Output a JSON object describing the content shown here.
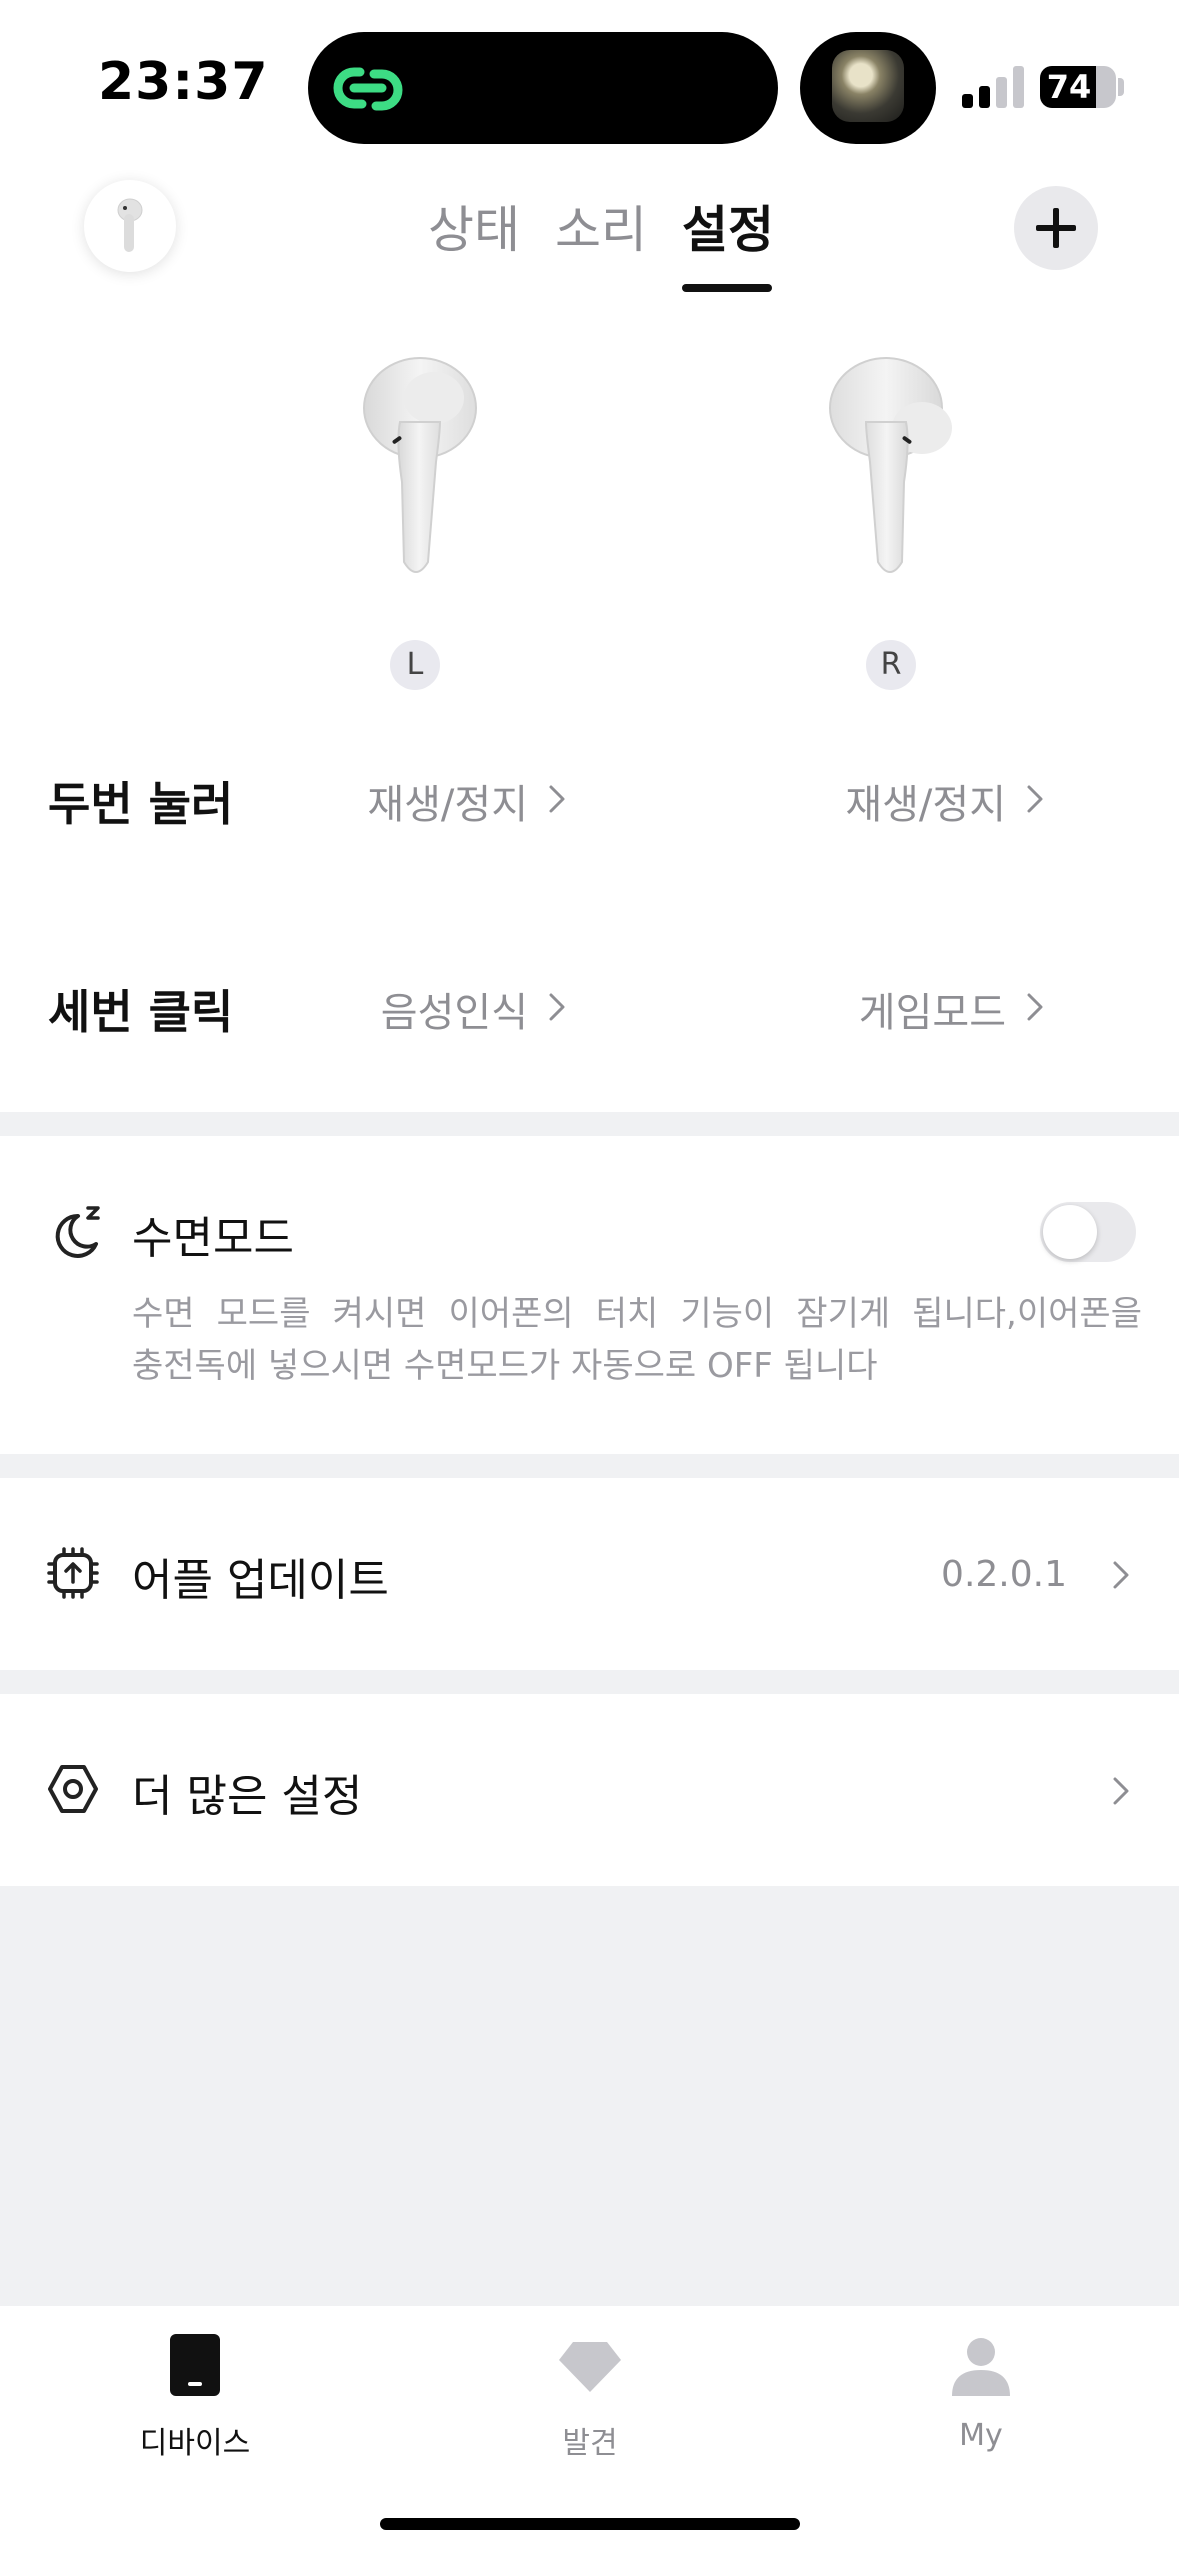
{
  "status_bar": {
    "time": "23:37",
    "battery": "74",
    "battery_level": 0.74,
    "signal_bars_active": 2
  },
  "header": {
    "tabs": [
      {
        "label": "상태",
        "active": false
      },
      {
        "label": "소리",
        "active": false
      },
      {
        "label": "설정",
        "active": true
      }
    ],
    "add_icon": "plus-icon",
    "device_thumb_icon": "earbud-icon"
  },
  "earbuds": {
    "left_label": "L",
    "right_label": "R"
  },
  "gestures": [
    {
      "title": "두번 눌러",
      "left": "재생/정지",
      "right": "재생/정지"
    },
    {
      "title": "세번 클릭",
      "left": "음성인식",
      "right": "게임모드"
    }
  ],
  "sleep_mode": {
    "icon": "moon-zz-icon",
    "title": "수면모드",
    "description_line1": "수면 모드를 켜시면 이어폰의 터치 기능이 잠기게 됩니다,이어폰을",
    "description_line2": "충전독에 넣으시면 수면모드가 자동으로 OFF 됩니다",
    "enabled": false
  },
  "firmware": {
    "icon": "chip-upload-icon",
    "title": "어플 업데이트",
    "version": "0.2.0.1"
  },
  "more_settings": {
    "icon": "hexagon-settings-icon",
    "title": "더 많은 설정"
  },
  "bottom_nav": [
    {
      "label": "디바이스",
      "icon": "device-icon",
      "active": true
    },
    {
      "label": "발견",
      "icon": "diamond-icon",
      "active": false
    },
    {
      "label": "My",
      "icon": "person-icon",
      "active": false
    }
  ],
  "colors": {
    "accent_green": "#3ddc84",
    "text_primary": "#111111",
    "text_secondary": "#8e8e93",
    "background": "#f0f1f3"
  }
}
